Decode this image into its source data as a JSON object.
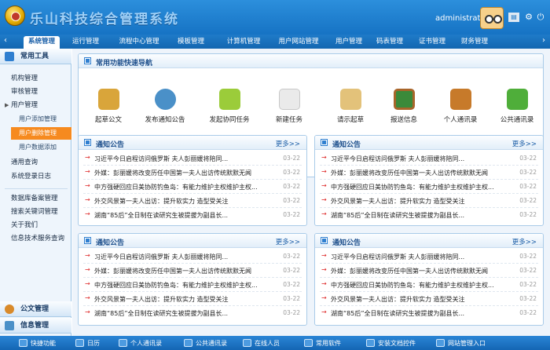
{
  "header": {
    "system_name": "乐山科技综合管理系统",
    "username": "administrator"
  },
  "topnav": {
    "tabs": [
      {
        "label": "系统管理",
        "active": true
      },
      {
        "label": "运行管理"
      },
      {
        "label": "流程中心管理"
      },
      {
        "label": "模板管理"
      },
      {
        "label": "计算机管理"
      },
      {
        "label": "用户网站管理"
      },
      {
        "label": "用户管理"
      },
      {
        "label": "码表管理"
      },
      {
        "label": "证书管理"
      },
      {
        "label": "财务管理"
      }
    ]
  },
  "sidebar": {
    "common_tools": "常用工具",
    "items": [
      "机构管理",
      "审核管理",
      "用户管理"
    ],
    "sub_items": [
      "用户添加管理",
      "用户删除管理",
      "用户数据添加"
    ],
    "items2": [
      "通用查询",
      "系统登录日志"
    ],
    "items3": [
      "数据库备案管理",
      "搜索关键词管理",
      "关于我们",
      "信息技术服务查询"
    ],
    "doc_management": "公文管理",
    "info_management": "信息管理"
  },
  "quick": {
    "title": "常用功能快速导航",
    "items": [
      {
        "label": "起草公文",
        "icon": "draft-document-icon",
        "color": "#d9a53a"
      },
      {
        "label": "发布通知公告",
        "icon": "publish-notice-icon",
        "color": "#4a90c8"
      },
      {
        "label": "发起协同任务",
        "icon": "collaboration-task-icon",
        "color": "#9bcc3a"
      },
      {
        "label": "新建任务",
        "icon": "new-task-icon",
        "color": "#e8e8e8"
      },
      {
        "label": "请示起草",
        "icon": "request-draft-icon",
        "color": "#e3c27a"
      },
      {
        "label": "报送信息",
        "icon": "submit-info-icon",
        "color": "#3b8a3a"
      },
      {
        "label": "个人通讯录",
        "icon": "personal-contacts-icon",
        "color": "#c77a2a"
      },
      {
        "label": "公共通讯录",
        "icon": "public-contacts-icon",
        "color": "#4fae3a"
      }
    ]
  },
  "notices": [
    {
      "title": "通知公告",
      "more": "更多>>",
      "rows": [
        {
          "text": "习近平今日启程访问俄罗斯 夫人彭丽媛将陪同...",
          "date": "03-22"
        },
        {
          "text": "外媒：彭丽媛将改变历任中国第一夫人出访传统默默无闻",
          "date": "03-22"
        },
        {
          "text": "中方强硬回应日美协防钓鱼岛：有能力维护主权维护主权...",
          "date": "03-22"
        },
        {
          "text": "外交风景第一夫人出访：提升软实力 造型受关注",
          "date": "03-22"
        },
        {
          "text": "湖南“85后”全日制在读研究生被提拔为副县长...",
          "date": "03-22"
        }
      ]
    },
    {
      "title": "通知公告",
      "more": "更多>>",
      "rows": [
        {
          "text": "习近平今日启程访问俄罗斯 夫人彭丽媛将陪同...",
          "date": "03-22"
        },
        {
          "text": "外媒：彭丽媛将改变历任中国第一夫人出访传统默默无闻",
          "date": "03-22"
        },
        {
          "text": "中方强硬回应日美协防钓鱼岛：有能力维护主权维护主权...",
          "date": "03-22"
        },
        {
          "text": "外交风景第一夫人出访：提升软实力 造型受关注",
          "date": "03-22"
        },
        {
          "text": "湖南“85后”全日制在读研究生被提拔为副县长...",
          "date": "03-22"
        }
      ]
    },
    {
      "title": "通知公告",
      "more": "更多>>",
      "rows": [
        {
          "text": "习近平今日启程访问俄罗斯 夫人彭丽媛将陪同...",
          "date": "03-22"
        },
        {
          "text": "外媒：彭丽媛将改变历任中国第一夫人出访传统默默无闻",
          "date": "03-22"
        },
        {
          "text": "中方强硬回应日美协防钓鱼岛：有能力维护主权维护主权...",
          "date": "03-22"
        },
        {
          "text": "外交风景第一夫人出访：提升软实力 造型受关注",
          "date": "03-22"
        },
        {
          "text": "湖南“85后”全日制在读研究生被提拔为副县长...",
          "date": "03-22"
        }
      ]
    },
    {
      "title": "通知公告",
      "more": "更多>>",
      "rows": [
        {
          "text": "习近平今日启程访问俄罗斯 夫人彭丽媛将陪同...",
          "date": "03-22"
        },
        {
          "text": "外媒：彭丽媛将改变历任中国第一夫人出访传统默默无闻",
          "date": "03-22"
        },
        {
          "text": "中方强硬回应日美协防钓鱼岛：有能力维护主权维护主权...",
          "date": "03-22"
        },
        {
          "text": "外交风景第一夫人出访：提升软实力 造型受关注",
          "date": "03-22"
        },
        {
          "text": "湖南“85后”全日制在读研究生被提拔为副县长...",
          "date": "03-22"
        }
      ]
    }
  ],
  "bottombar": {
    "items": [
      "快捷功能",
      "日历",
      "个人通讯录",
      "公共通讯录",
      "在线人员",
      "常用软件",
      "安装文档控件",
      "网站管理入口"
    ]
  }
}
